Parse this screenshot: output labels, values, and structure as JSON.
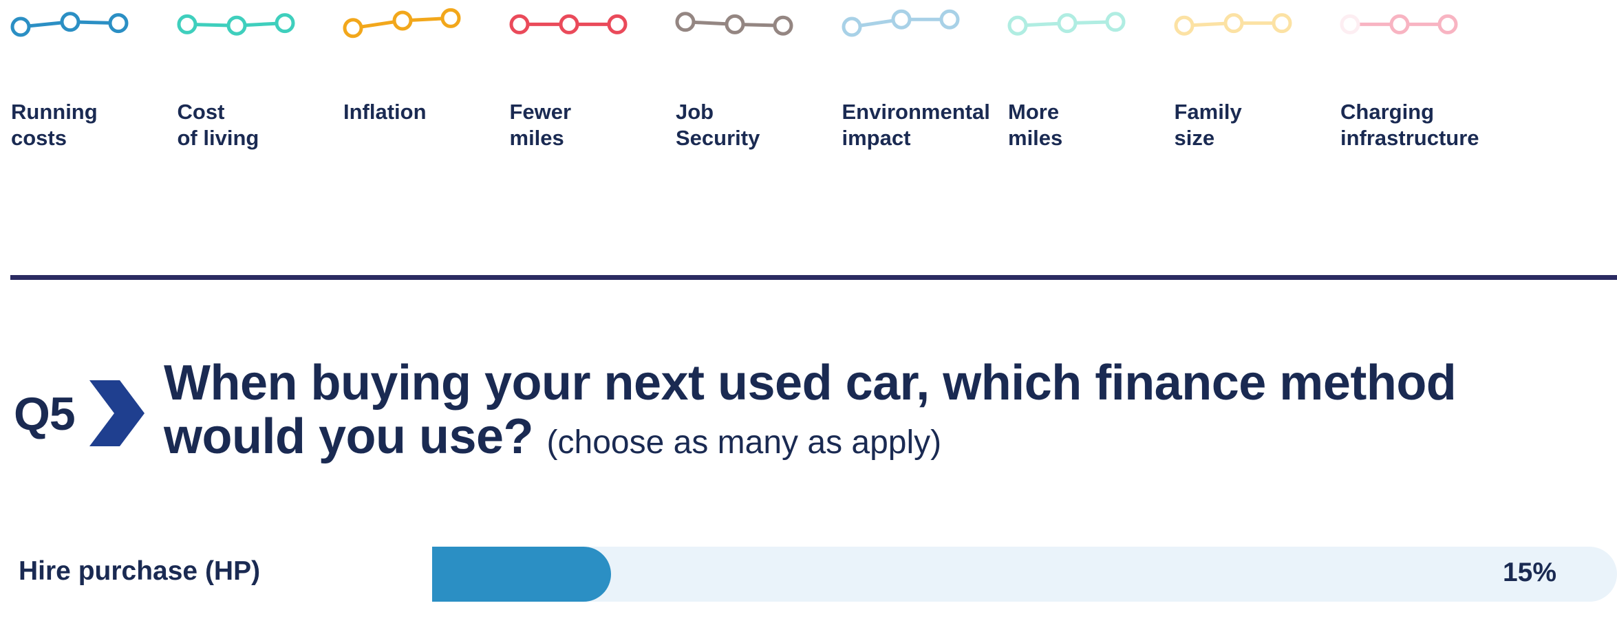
{
  "chart_data": [
    {
      "type": "line",
      "legend": [
        {
          "label_lines": [
            "Running",
            "costs"
          ],
          "color": "#2b8fc4",
          "shape": [
            0.75,
            0.55,
            0.6
          ]
        },
        {
          "label_lines": [
            "Cost",
            "of living"
          ],
          "color": "#3fcfbd",
          "shape": [
            0.65,
            0.7,
            0.6
          ]
        },
        {
          "label_lines": [
            "Inflation"
          ],
          "color": "#f2a71b",
          "shape": [
            0.8,
            0.5,
            0.4
          ]
        },
        {
          "label_lines": [
            "Fewer",
            "miles"
          ],
          "color": "#ea4a5a",
          "shape": [
            0.65,
            0.65,
            0.65
          ]
        },
        {
          "label_lines": [
            "Job",
            "Security"
          ],
          "color": "#948682",
          "shape": [
            0.55,
            0.65,
            0.7
          ]
        },
        {
          "label_lines": [
            "Environmental",
            "impact"
          ],
          "color": "#a8d1e7",
          "shape": [
            0.75,
            0.45,
            0.45
          ]
        },
        {
          "label_lines": [
            "More",
            "miles"
          ],
          "color": "#b0ede2",
          "shape": [
            0.7,
            0.6,
            0.55
          ]
        },
        {
          "label_lines": [
            "Family",
            "size"
          ],
          "color": "#fce2a4",
          "shape": [
            0.7,
            0.6,
            0.6
          ]
        },
        {
          "label_lines": [
            "Charging",
            "infrastructure"
          ],
          "color": "#f8b4c2",
          "first_point_color": "#fdeef2",
          "shape": [
            0.65,
            0.65,
            0.65
          ]
        }
      ]
    },
    {
      "type": "bar",
      "orientation": "horizontal",
      "categories": [
        "Hire purchase (HP)"
      ],
      "values": [
        15
      ],
      "value_labels": [
        "15%"
      ],
      "xlim": [
        0,
        100
      ],
      "colors": {
        "fill": "#2b8fc4",
        "track": "#eaf3fa"
      }
    }
  ],
  "question": {
    "number": "Q5",
    "line1": "When buying your next used car, which finance method",
    "line2": "would you use?",
    "note": "(choose as many as apply)"
  },
  "colors": {
    "text": "#1a2a52",
    "divider": "#2b2b62"
  }
}
